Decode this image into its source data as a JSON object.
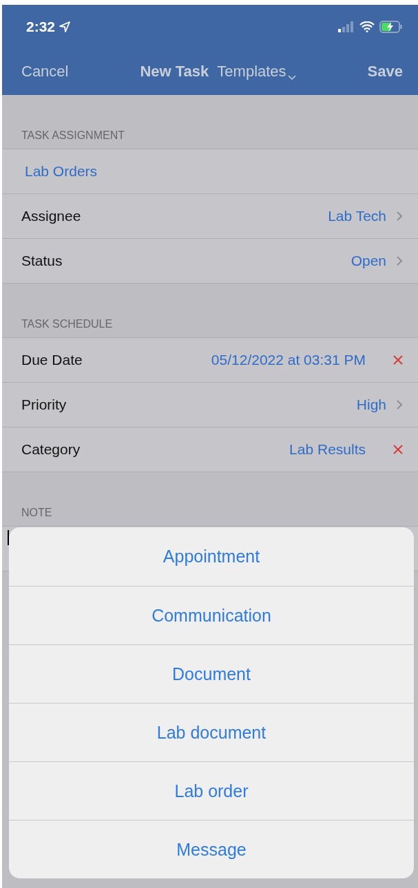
{
  "status_bar": {
    "time": "2:32"
  },
  "nav": {
    "cancel": "Cancel",
    "title": "New Task",
    "templates": "Templates",
    "save": "Save"
  },
  "sections": [
    {
      "header": "TASK ASSIGNMENT",
      "rows": [
        {
          "kind": "link",
          "label": "Lab Orders"
        },
        {
          "kind": "disclosure",
          "label": "Assignee",
          "value": "Lab Tech"
        },
        {
          "kind": "disclosure",
          "label": "Status",
          "value": "Open"
        }
      ]
    },
    {
      "header": "TASK SCHEDULE",
      "rows": [
        {
          "kind": "clearable",
          "label": "Due Date",
          "value": "05/12/2022 at 03:31 PM"
        },
        {
          "kind": "disclosure",
          "label": "Priority",
          "value": "High"
        },
        {
          "kind": "clearable",
          "label": "Category",
          "value": "Lab Results"
        }
      ]
    },
    {
      "header": "NOTE",
      "rows": [
        {
          "kind": "note"
        }
      ]
    }
  ],
  "action_sheet": {
    "options": [
      "Appointment",
      "Communication",
      "Document",
      "Lab document",
      "Lab order",
      "Message"
    ]
  }
}
